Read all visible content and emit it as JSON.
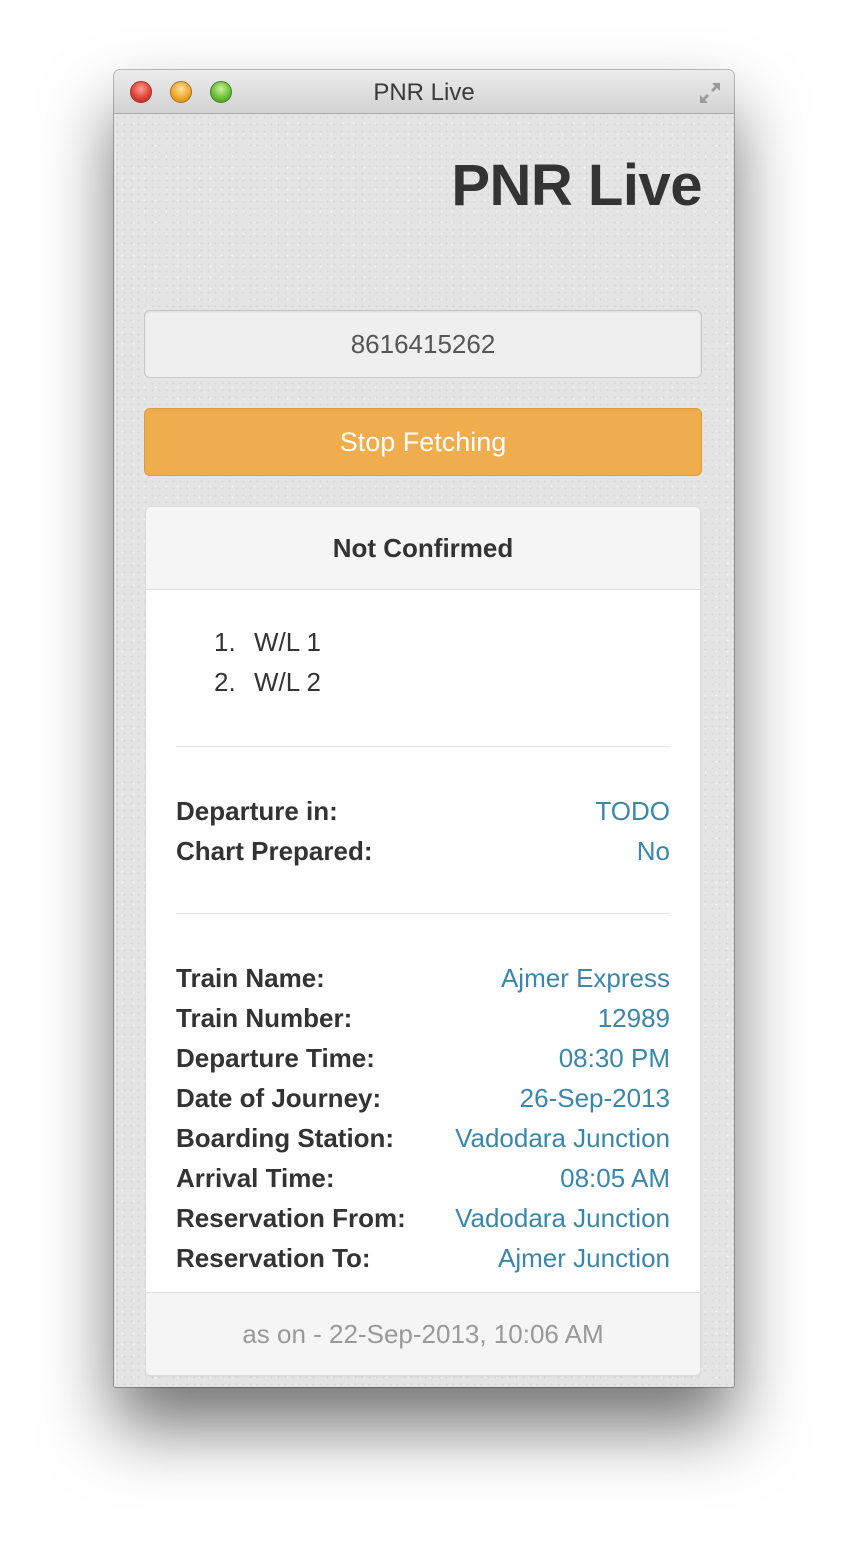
{
  "window": {
    "title": "PNR Live"
  },
  "app": {
    "heading": "PNR Live"
  },
  "pnr_input": {
    "value": "8616415262"
  },
  "actions": {
    "stop_label": "Stop Fetching"
  },
  "status": {
    "heading": "Not Confirmed",
    "passengers": [
      {
        "number": "1.",
        "status": "W/L 1"
      },
      {
        "number": "2.",
        "status": "W/L 2"
      }
    ]
  },
  "summary": [
    {
      "label": "Departure in:",
      "value": "TODO"
    },
    {
      "label": "Chart Prepared:",
      "value": "No"
    }
  ],
  "journey": [
    {
      "label": "Train Name:",
      "value": "Ajmer Express"
    },
    {
      "label": "Train Number:",
      "value": "12989"
    },
    {
      "label": "Departure Time:",
      "value": "08:30 PM"
    },
    {
      "label": "Date of Journey:",
      "value": "26-Sep-2013"
    },
    {
      "label": "Boarding Station:",
      "value": "Vadodara Junction"
    },
    {
      "label": "Arrival Time:",
      "value": "08:05 AM"
    },
    {
      "label": "Reservation From:",
      "value": "Vadodara Junction"
    },
    {
      "label": "Reservation To:",
      "value": "Ajmer Junction"
    }
  ],
  "footer": {
    "timestamp": "as on - 22-Sep-2013, 10:06 AM"
  },
  "colors": {
    "button": "#f0ad4e",
    "value_text": "#3a87ad",
    "label_text": "#333333",
    "footer_text": "#999999"
  },
  "icons": {
    "close": "close-icon",
    "minimize": "minimize-icon",
    "zoom": "zoom-icon",
    "fullscreen": "fullscreen-icon"
  }
}
